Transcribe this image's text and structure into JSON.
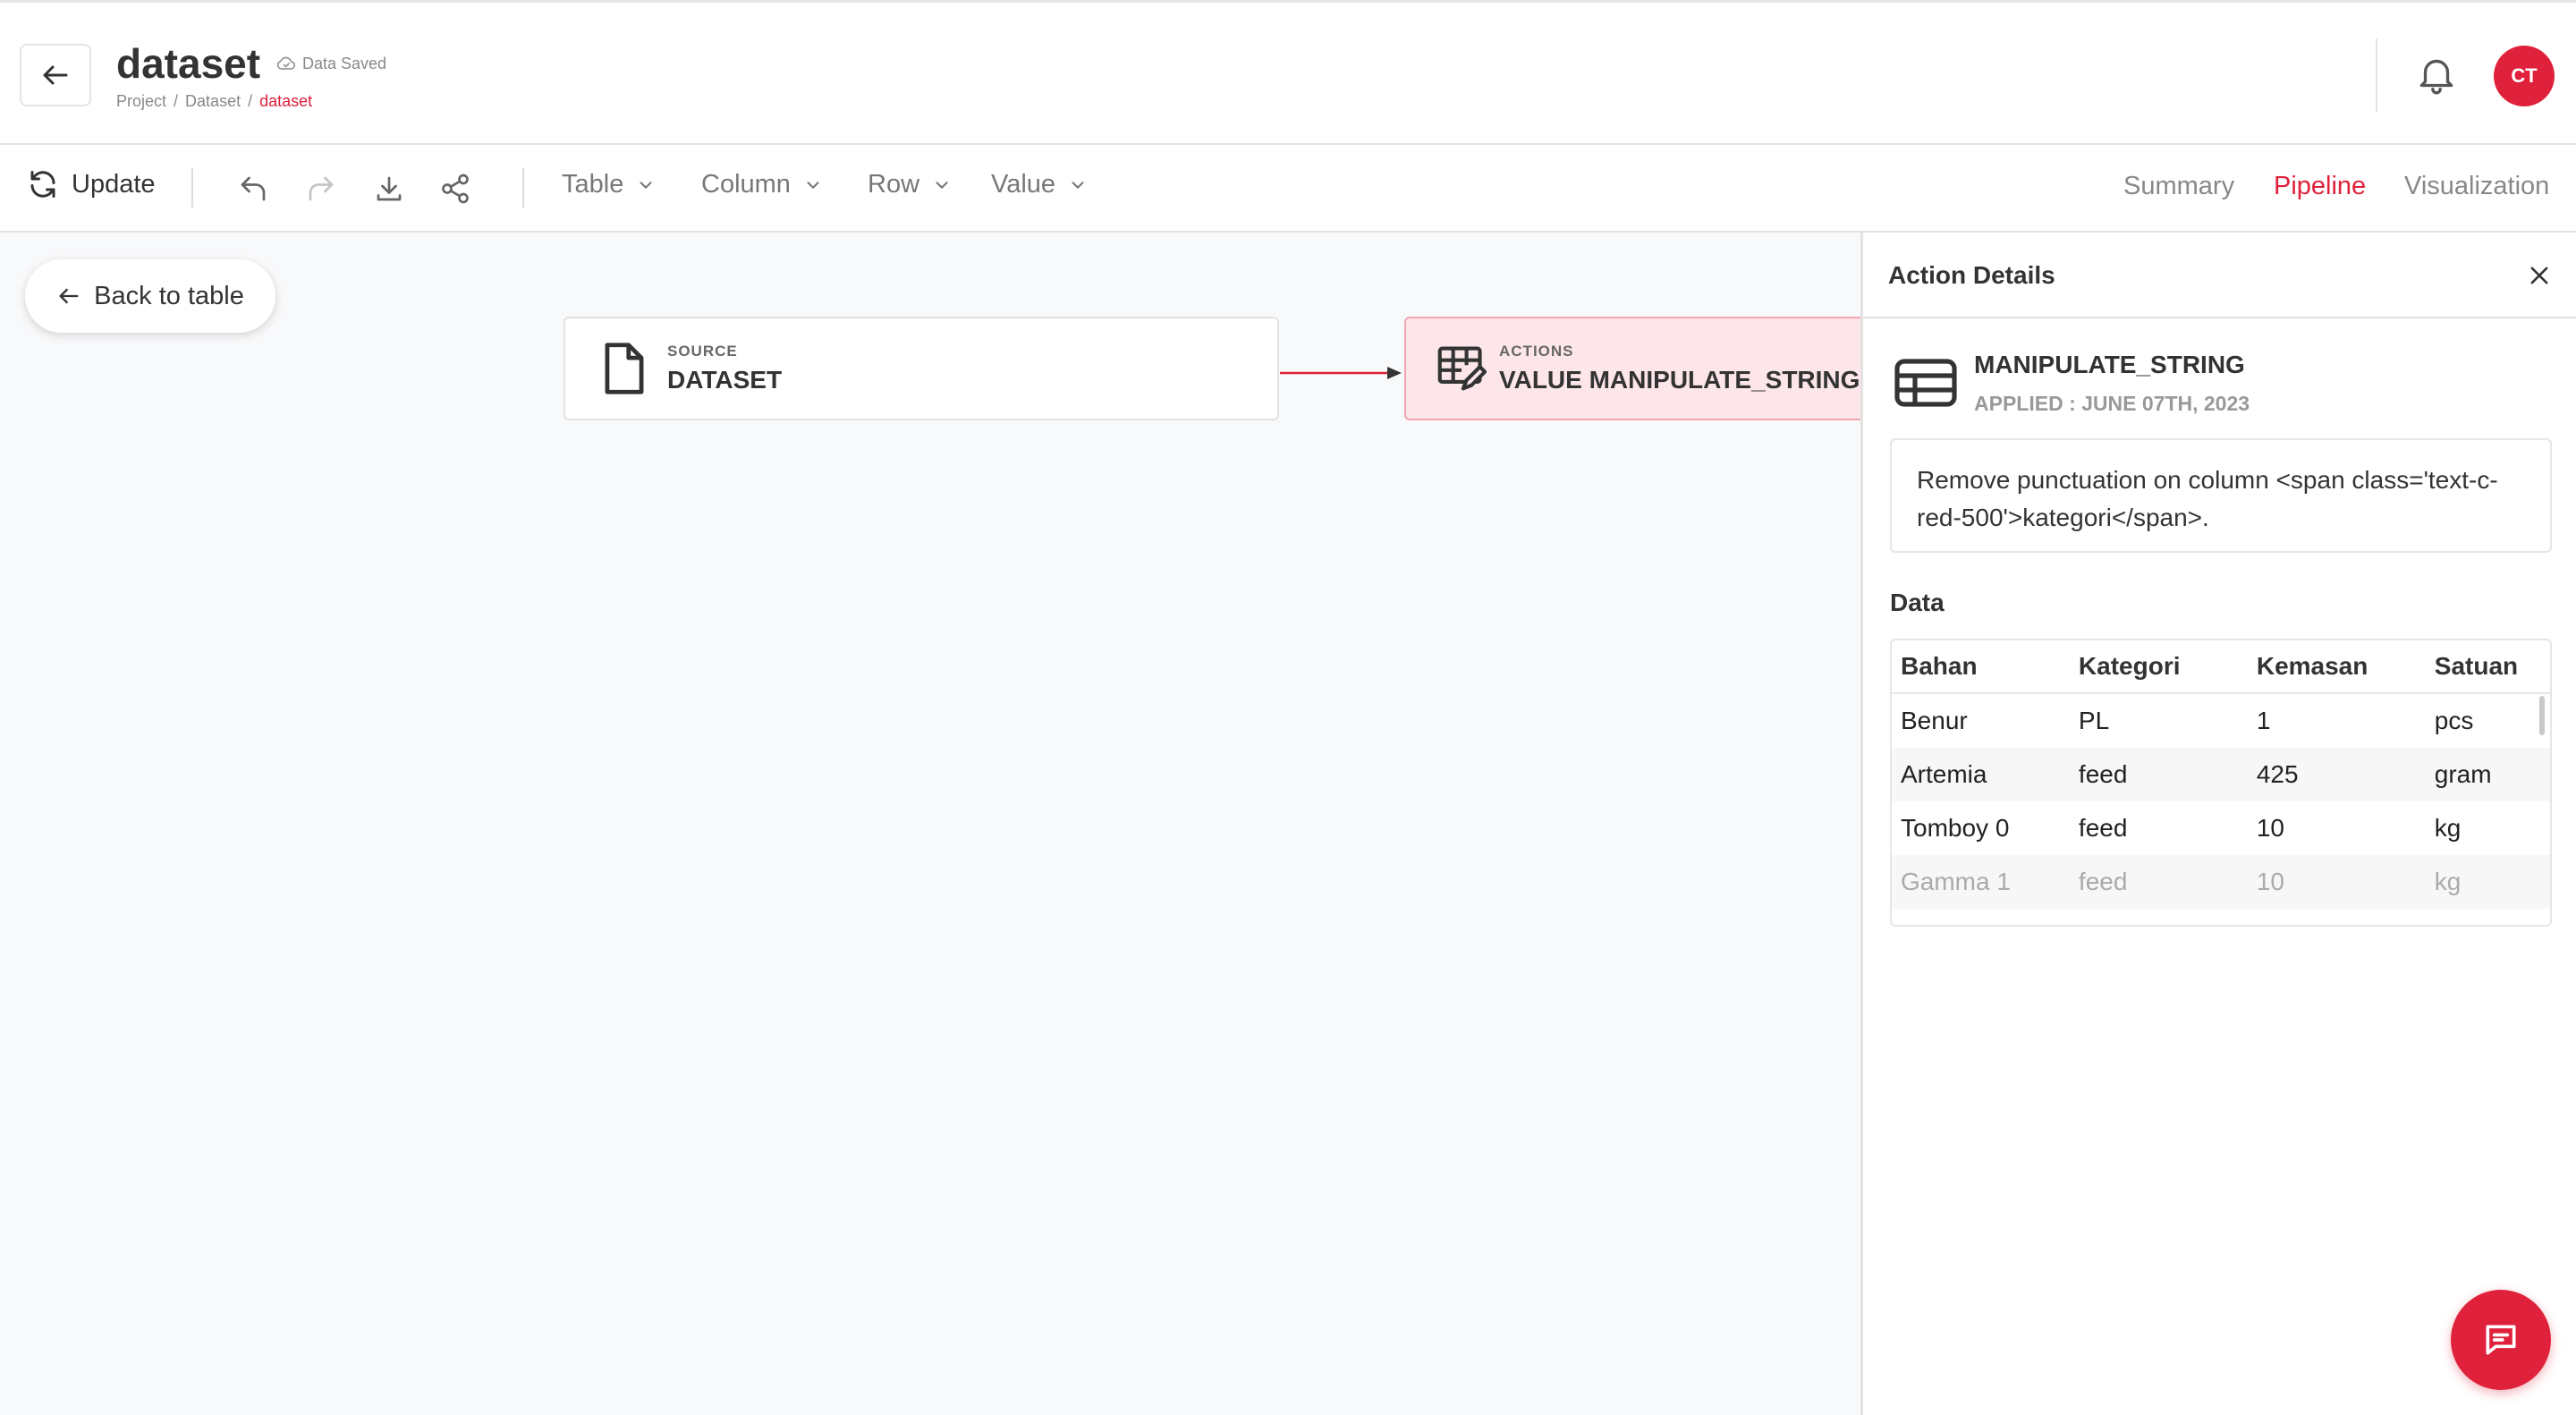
{
  "header": {
    "title": "dataset",
    "save_status": "Data Saved",
    "breadcrumb": [
      "Project",
      "Dataset",
      "dataset"
    ],
    "avatar_initials": "CT"
  },
  "toolbar": {
    "update_label": "Update",
    "menus": [
      "Table",
      "Column",
      "Row",
      "Value"
    ],
    "tabs": [
      "Summary",
      "Pipeline",
      "Visualization"
    ],
    "active_tab": "Pipeline"
  },
  "canvas": {
    "back_label": "Back to table",
    "source_node": {
      "kicker": "SOURCE",
      "name": "DATASET"
    },
    "action_node": {
      "kicker": "ACTIONS",
      "name": "VALUE MANIPULATE_STRING"
    }
  },
  "panel": {
    "title": "Action Details",
    "action_name": "MANIPULATE_STRING",
    "applied": "APPLIED : JUNE 07TH, 2023",
    "description": "Remove punctuation on column <span class='text-c-red-500'>kategori</span>.",
    "data_label": "Data",
    "columns": [
      "Bahan",
      "Kategori",
      "Kemasan",
      "Satuan"
    ],
    "rows": [
      [
        "Benur",
        "PL",
        "1",
        "pcs"
      ],
      [
        "Artemia",
        "feed",
        "425",
        "gram"
      ],
      [
        "Tomboy 0",
        "feed",
        "10",
        "kg"
      ],
      [
        "Gamma 1",
        "feed",
        "10",
        "kg"
      ]
    ]
  },
  "colors": {
    "accent": "#e0213b",
    "node_action_bg": "#fde6ea"
  },
  "icons": [
    "back-arrow-icon",
    "cloud-check-icon",
    "bell-icon",
    "refresh-icon",
    "undo-icon",
    "redo-icon",
    "download-icon",
    "share-icon",
    "chevron-down-icon",
    "file-icon",
    "table-edit-icon",
    "close-icon",
    "table-icon",
    "chat-icon"
  ]
}
